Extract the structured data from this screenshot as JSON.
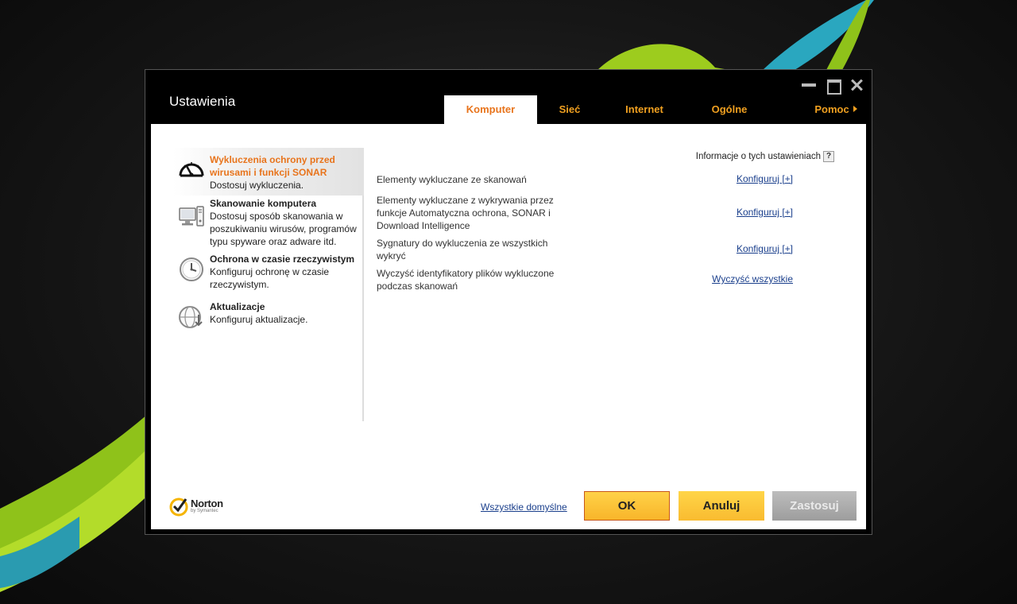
{
  "window": {
    "title": "Ustawienia"
  },
  "tabs": [
    {
      "label": "Komputer",
      "active": true
    },
    {
      "label": "Sieć",
      "active": false
    },
    {
      "label": "Internet",
      "active": false
    },
    {
      "label": "Ogólne",
      "active": false
    },
    {
      "label": "Pomoc",
      "active": false
    }
  ],
  "sidebar": {
    "items": [
      {
        "title": "Wykluczenia ochrony przed wirusami i funkcji SONAR",
        "desc": "Dostosuj wykluczenia.",
        "icon": "speedometer-icon",
        "active": true
      },
      {
        "title": "Skanowanie komputera",
        "desc": "Dostosuj sposób skanowania w poszukiwaniu wirusów, programów typu spyware oraz adware itd.",
        "icon": "computer-icon",
        "active": false
      },
      {
        "title": "Ochrona w czasie rzeczywistym",
        "desc": "Konfiguruj ochronę w czasie rzeczywistym.",
        "icon": "clock-icon",
        "active": false
      },
      {
        "title": "Aktualizacje",
        "desc": "Konfiguruj aktualizacje.",
        "icon": "globe-update-icon",
        "active": false
      }
    ]
  },
  "main": {
    "info_label": "Informacje o tych ustawieniach",
    "help_glyph": "?",
    "rows": [
      {
        "label": "Elementy wykluczane ze skanowań",
        "action": "Konfiguruj [+]"
      },
      {
        "label": "Elementy wykluczane z wykrywania przez funkcje Automatyczna ochrona, SONAR i Download Intelligence",
        "action": "Konfiguruj [+]"
      },
      {
        "label": "Sygnatury do wykluczenia ze wszystkich wykryć",
        "action": "Konfiguruj [+]"
      },
      {
        "label": "Wyczyść identyfikatory plików wykluczone podczas skanowań",
        "action": "Wyczyść wszystkie"
      }
    ]
  },
  "footer": {
    "logo_name": "Norton",
    "logo_sub": "by Symantec",
    "defaults_link": "Wszystkie domyślne",
    "ok_label": "OK",
    "cancel_label": "Anuluj",
    "apply_label": "Zastosuj"
  },
  "colors": {
    "accent": "#e8741c",
    "tab_text": "#f0a020",
    "link": "#1a3f8c",
    "button_yellow": "#f9bb30"
  }
}
